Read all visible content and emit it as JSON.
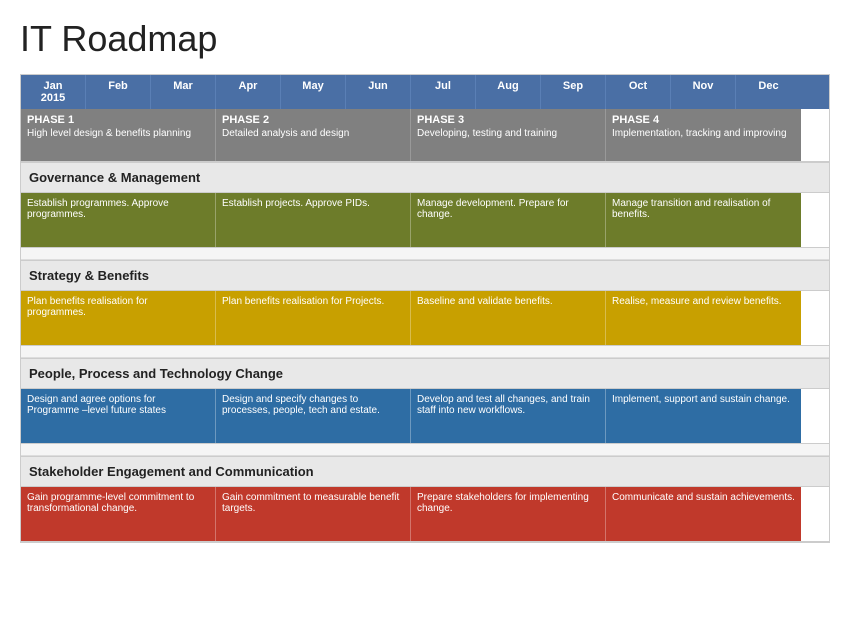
{
  "title": "IT Roadmap",
  "header": {
    "months": [
      {
        "label": "Jan\n2015"
      },
      {
        "label": "Feb"
      },
      {
        "label": "Mar"
      },
      {
        "label": "Apr"
      },
      {
        "label": "May"
      },
      {
        "label": "Jun"
      },
      {
        "label": "Jul"
      },
      {
        "label": "Aug"
      },
      {
        "label": "Sep"
      },
      {
        "label": "Oct"
      },
      {
        "label": "Nov"
      },
      {
        "label": "Dec"
      }
    ]
  },
  "phases": [
    {
      "title": "PHASE 1",
      "desc": "High level design & benefits planning"
    },
    {
      "title": "PHASE 2",
      "desc": "Detailed analysis and design"
    },
    {
      "title": "PHASE 3",
      "desc": "Developing, testing and training"
    },
    {
      "title": "PHASE 4",
      "desc": "Implementation, tracking and improving"
    }
  ],
  "sections": [
    {
      "name": "Governance & Management",
      "tasks": [
        {
          "text": "Establish programmes. Approve programmes.",
          "color": "col-olive"
        },
        {
          "text": "Establish projects. Approve PIDs.",
          "color": "col-olive"
        },
        {
          "text": "Manage development. Prepare for change.",
          "color": "col-olive"
        },
        {
          "text": "Manage transition and realisation of benefits.",
          "color": "col-olive"
        }
      ]
    },
    {
      "name": "Strategy & Benefits",
      "tasks": [
        {
          "text": "Plan benefits realisation for programmes.",
          "color": "col-yellow"
        },
        {
          "text": "Plan benefits realisation for Projects.",
          "color": "col-yellow"
        },
        {
          "text": "Baseline and validate benefits.",
          "color": "col-yellow"
        },
        {
          "text": "Realise, measure and review benefits.",
          "color": "col-yellow"
        }
      ]
    },
    {
      "name": "People, Process and Technology Change",
      "tasks": [
        {
          "text": "Design and agree options for Programme –level future states",
          "color": "col-blue"
        },
        {
          "text": "Design and specify changes to processes, people, tech and estate.",
          "color": "col-blue"
        },
        {
          "text": "Develop and test all changes, and train staff into new workflows.",
          "color": "col-blue"
        },
        {
          "text": "Implement, support and sustain change.",
          "color": "col-blue"
        }
      ]
    },
    {
      "name": "Stakeholder Engagement and Communication",
      "tasks": [
        {
          "text": "Gain programme-level commitment to transformational change.",
          "color": "col-red"
        },
        {
          "text": "Gain commitment to measurable benefit targets.",
          "color": "col-red"
        },
        {
          "text": "Prepare stakeholders for implementing change.",
          "color": "col-red"
        },
        {
          "text": "Communicate and sustain achievements.",
          "color": "col-red"
        }
      ]
    }
  ]
}
